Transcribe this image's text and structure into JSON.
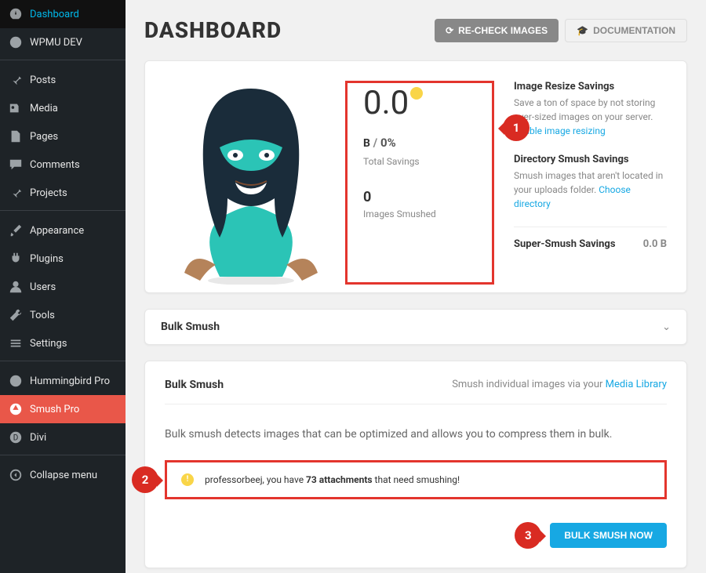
{
  "sidebar": {
    "items": [
      {
        "label": "Dashboard"
      },
      {
        "label": "WPMU DEV"
      },
      {
        "label": "Posts"
      },
      {
        "label": "Media"
      },
      {
        "label": "Pages"
      },
      {
        "label": "Comments"
      },
      {
        "label": "Projects"
      },
      {
        "label": "Appearance"
      },
      {
        "label": "Plugins"
      },
      {
        "label": "Users"
      },
      {
        "label": "Tools"
      },
      {
        "label": "Settings"
      },
      {
        "label": "Hummingbird Pro"
      },
      {
        "label": "Smush Pro"
      },
      {
        "label": "Divi"
      },
      {
        "label": "Collapse menu"
      }
    ]
  },
  "header": {
    "title": "DASHBOARD",
    "recheck": "RE-CHECK IMAGES",
    "docs": "DOCUMENTATION"
  },
  "stats": {
    "value": "0.0",
    "unit": "B",
    "sep": " / ",
    "pct": "0%",
    "total_label": "Total Savings",
    "count": "0",
    "count_label": "Images Smushed"
  },
  "sidecol": {
    "resize_title": "Image Resize Savings",
    "resize_text": "Save a ton of space by not storing over-sized images on your server. ",
    "resize_link": "Enable image resizing",
    "dir_title": "Directory Smush Savings",
    "dir_text": "Smush images that aren't located in your uploads folder. ",
    "dir_link": "Choose directory",
    "super_title": "Super-Smush Savings",
    "super_val": "0.0 B"
  },
  "accordion": {
    "title": "Bulk Smush"
  },
  "bulk": {
    "title": "Bulk Smush",
    "via_prefix": "Smush individual images via your ",
    "via_link": "Media Library",
    "desc": "Bulk smush detects images that can be optimized and allows you to compress them in bulk.",
    "notice_pre": "professorbeej, you have ",
    "notice_strong": "73 attachments",
    "notice_post": " that need smushing!",
    "action": "BULK SMUSH NOW"
  },
  "markers": {
    "m1": "1",
    "m2": "2",
    "m3": "3"
  }
}
